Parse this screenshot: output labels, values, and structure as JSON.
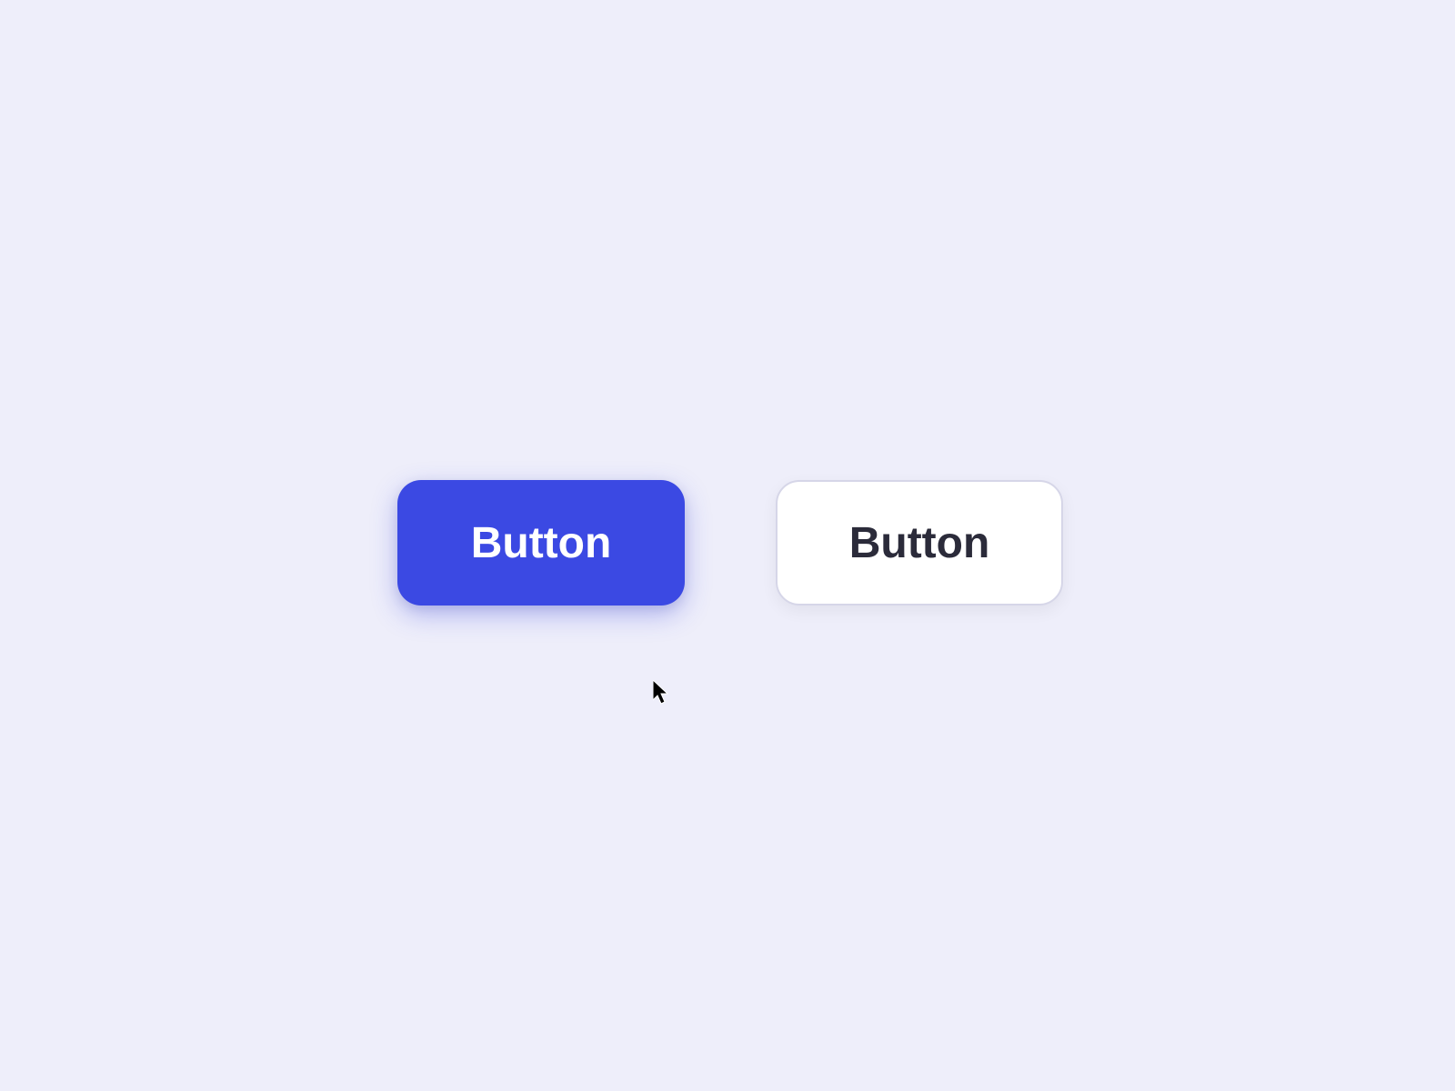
{
  "buttons": {
    "primary": {
      "label": "Button"
    },
    "secondary": {
      "label": "Button"
    }
  },
  "colors": {
    "background": "#eeeefa",
    "primary": "#3b49e3",
    "secondary_bg": "#ffffff",
    "secondary_text": "#2b2b3a",
    "secondary_border": "#d6d6e8"
  }
}
